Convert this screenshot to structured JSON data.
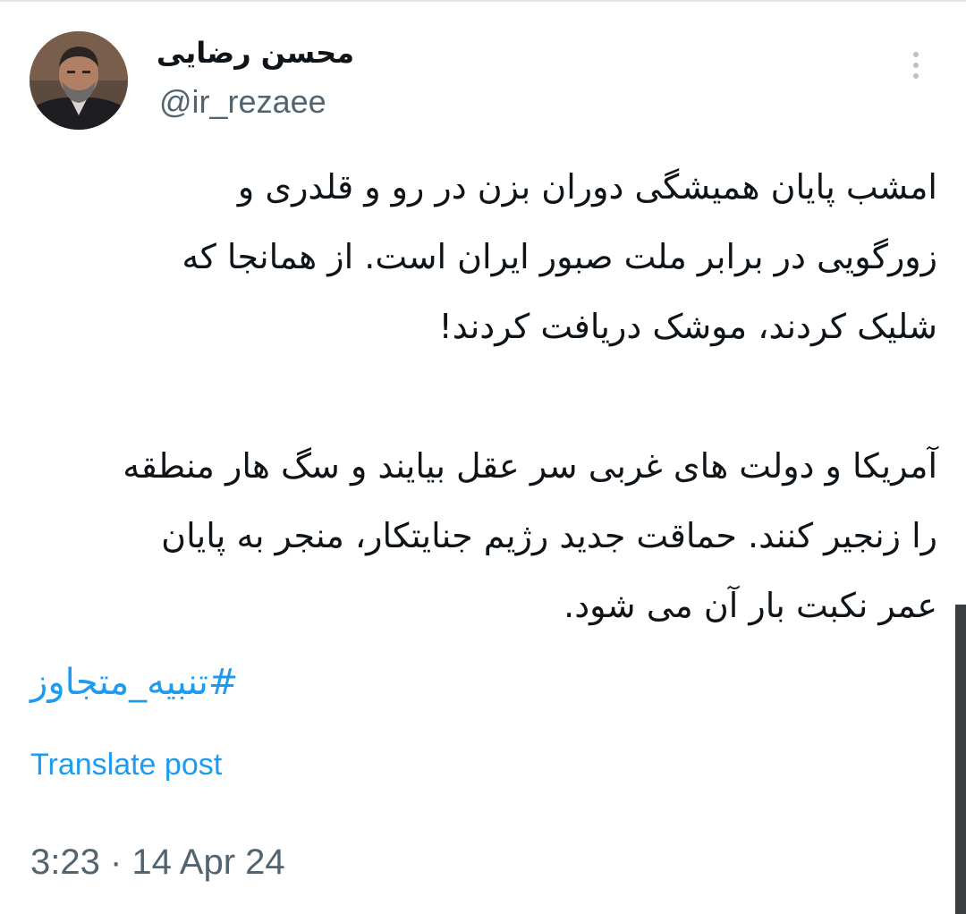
{
  "author": {
    "display_name": "محسن رضایی",
    "handle": "@ir_rezaee",
    "avatar_icon": "profile-photo"
  },
  "tweet": {
    "paragraph_1_lines": [
      "امشب پایان همیشگی دوران بزن در رو و قلدری و",
      "زورگویی در برابر ملت صبور ایران است. از همانجا که",
      "شلیک کردند، موشک دریافت کردند!"
    ],
    "paragraph_2_lines": [
      "آمریکا و دولت های غربی سر عقل بیایند و سگ هار منطقه",
      "را زنجیر کنند. حماقت جدید رژیم جنایتکار، منجر به پایان",
      "عمر نکبت بار آن می شود."
    ],
    "hashtag": "#تنبیه_متجاوز",
    "translate_label": "Translate post",
    "timestamp": "3:23 · 14 Apr 24"
  },
  "icons": {
    "more": "more-vertical-icon"
  },
  "colors": {
    "link": "#1d9bf0",
    "text": "#0f1419",
    "secondary": "#536471"
  }
}
